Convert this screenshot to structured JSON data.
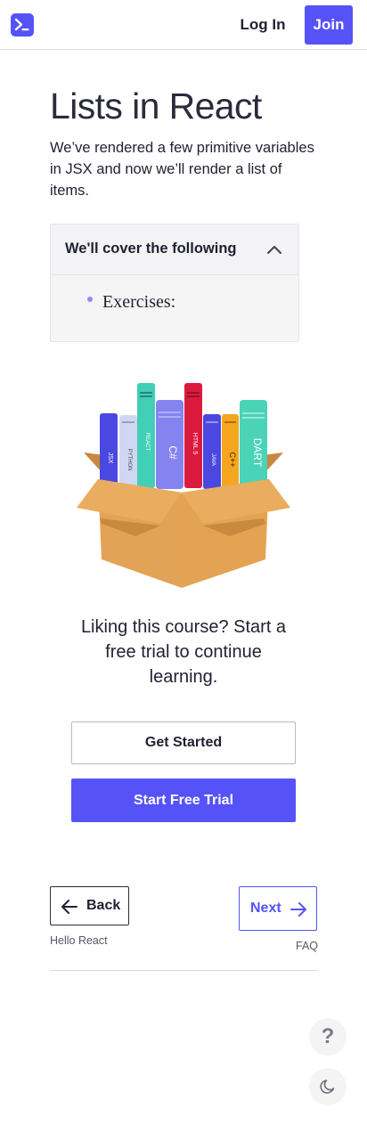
{
  "header": {
    "logo_icon": "terminal-icon",
    "login_label": "Log In",
    "join_label": "Join",
    "accent_color": "#5553f8"
  },
  "lesson": {
    "title": "Lists in React",
    "intro": "We’ve rendered a few primitive variables in JSX and now we’ll render a list of items."
  },
  "cover": {
    "title": "We'll cover the following",
    "toggle_icon": "chevron-up-icon",
    "items": [
      "Exercises:"
    ]
  },
  "promo": {
    "illustration": "course-books-box-illustration",
    "book_labels": [
      "JSX",
      "PYTHON",
      "REACT",
      "C#",
      "HTML 5",
      "JAVA",
      "C++",
      "DART"
    ],
    "text": "Liking this course? Start a free trial to continue learning.",
    "get_started_label": "Get Started",
    "free_trial_label": "Start Free Trial"
  },
  "navigation": {
    "back_label": "Back",
    "back_icon": "arrow-left-icon",
    "previous_lesson": "Hello React",
    "next_label": "Next",
    "next_icon": "arrow-right-icon",
    "next_lesson": "FAQ"
  },
  "floating": {
    "help_label": "?",
    "help_icon": "question-icon",
    "theme_icon": "moon-icon"
  }
}
